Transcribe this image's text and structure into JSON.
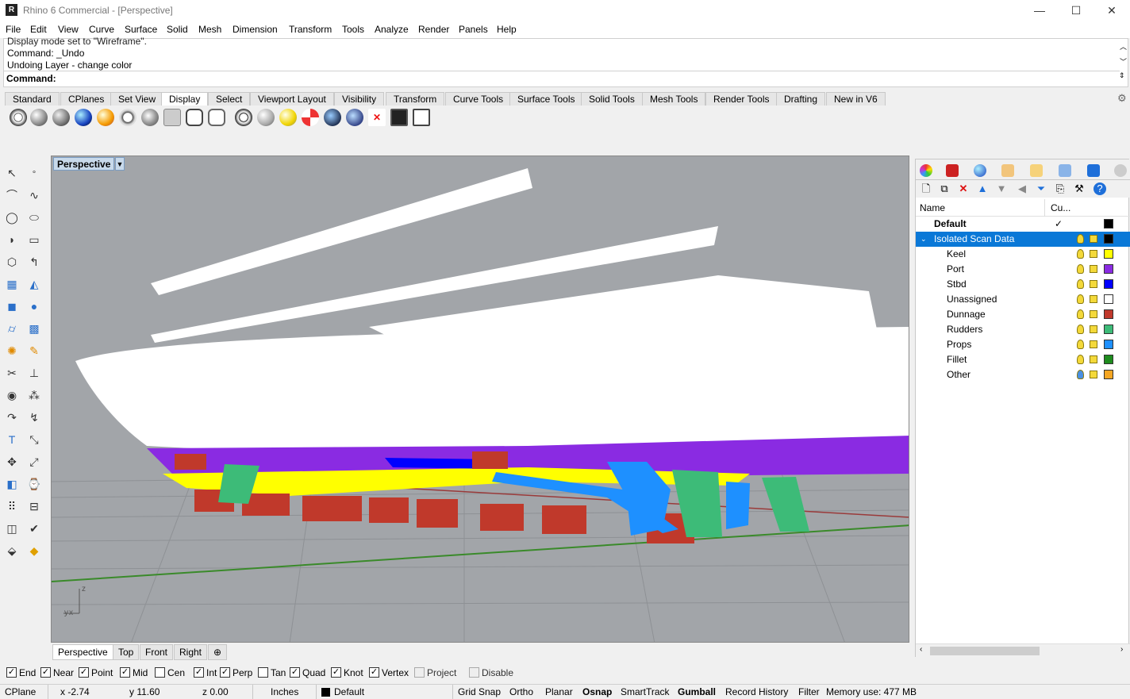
{
  "window": {
    "title": "Rhino 6 Commercial - [Perspective]",
    "minimize": "—",
    "maximize": "☐",
    "close": "✕"
  },
  "menu": [
    "File",
    "Edit",
    "View",
    "Curve",
    "Surface",
    "Solid",
    "Mesh",
    "Dimension",
    "Transform",
    "Tools",
    "Analyze",
    "Render",
    "Panels",
    "Help"
  ],
  "command_history": [
    "Display mode set to \"Wireframe\".",
    "Command: _Undo",
    "Undoing Layer - change color"
  ],
  "command_prompt": "Command:",
  "toolbar_tabs": [
    "Standard",
    "CPlanes",
    "Set View",
    "Display",
    "Select",
    "Viewport Layout",
    "Visibility",
    "Transform",
    "Curve Tools",
    "Surface Tools",
    "Solid Tools",
    "Mesh Tools",
    "Render Tools",
    "Drafting",
    "New in V6"
  ],
  "active_toolbar_tab": "Display",
  "viewport": {
    "title": "Perspective",
    "axis_z": "z",
    "axis_x": "x",
    "axis_y": "y"
  },
  "viewport_tabs": [
    "Perspective",
    "Top",
    "Front",
    "Right"
  ],
  "viewport_add_tab": "⊕",
  "layers": {
    "header_name": "Name",
    "header_current": "Cu...",
    "rows": [
      {
        "name": "Default",
        "current": "✓",
        "color": "#000000",
        "bold": true
      },
      {
        "name": "Isolated Scan Data",
        "color": "#000000",
        "selected": true
      },
      {
        "name": "Keel",
        "color": "#ffff00"
      },
      {
        "name": "Port",
        "color": "#8a2be2"
      },
      {
        "name": "Stbd",
        "color": "#0000ff"
      },
      {
        "name": "Unassigned",
        "color": "#ffffff"
      },
      {
        "name": "Dunnage",
        "color": "#c0392b"
      },
      {
        "name": "Rudders",
        "color": "#3dbb78"
      },
      {
        "name": "Props",
        "color": "#1e90ff"
      },
      {
        "name": "Fillet",
        "color": "#1e8c1e"
      },
      {
        "name": "Other",
        "color": "#f5a623"
      }
    ]
  },
  "osnaps": [
    {
      "label": "End",
      "checked": true
    },
    {
      "label": "Near",
      "checked": true
    },
    {
      "label": "Point",
      "checked": true
    },
    {
      "label": "Mid",
      "checked": true
    },
    {
      "label": "Cen",
      "checked": false
    },
    {
      "label": "Int",
      "checked": true
    },
    {
      "label": "Perp",
      "checked": true
    },
    {
      "label": "Tan",
      "checked": false
    },
    {
      "label": "Quad",
      "checked": true
    },
    {
      "label": "Knot",
      "checked": true
    },
    {
      "label": "Vertex",
      "checked": true
    },
    {
      "label": "Project",
      "checked": false,
      "disabled": true
    },
    {
      "label": "Disable",
      "checked": false,
      "disabled": true
    }
  ],
  "status": {
    "cplane": "CPlane",
    "x": "x -2.74",
    "y": "y 11.60",
    "z": "z 0.00",
    "units": "Inches",
    "layer": "Default",
    "grid_snap": "Grid Snap",
    "ortho": "Ortho",
    "planar": "Planar",
    "osnap": "Osnap",
    "smarttrack": "SmartTrack",
    "gumball": "Gumball",
    "record_history": "Record History",
    "filter": "Filter",
    "memory": "Memory use: 477 MB"
  },
  "colors": {
    "viewport_bg": "#a2a5a9",
    "selection": "#0a78d7",
    "hull_port": "#8a2be2",
    "keel": "#ffff00",
    "dunnage": "#c0392b",
    "rudders": "#3dbb78",
    "props": "#1e90ff",
    "stbd": "#0000ff"
  }
}
